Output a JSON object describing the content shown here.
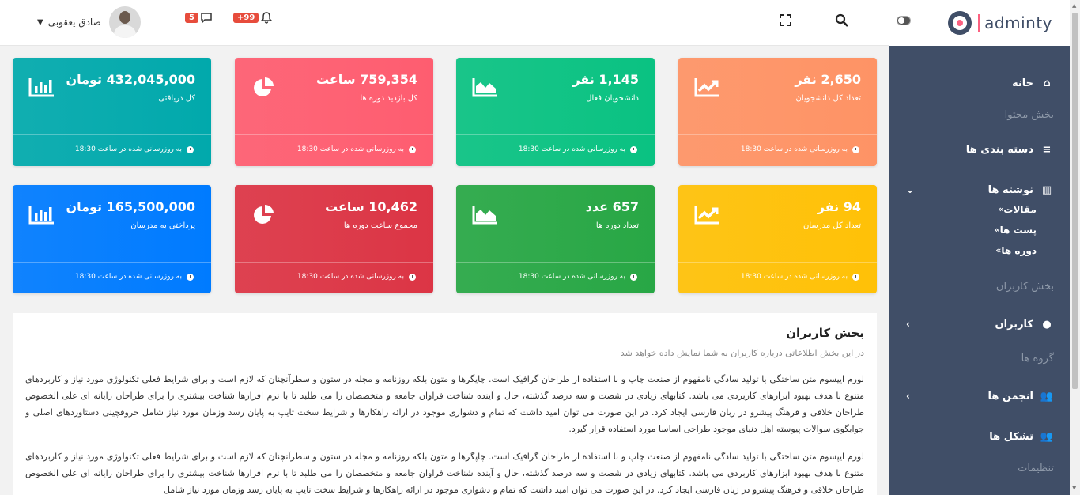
{
  "topbar": {
    "user_name": "صادق یعقوبی",
    "messages_count": "5",
    "notifications_count": "+99"
  },
  "sidebar": {
    "logo_text": "adminty",
    "home": "خانه",
    "caption_content": "بخش محتوا",
    "categories": "دسته بندی ها",
    "posts": "نوشته ها",
    "sub_articles": "مقالات",
    "sub_posts": "پست ها",
    "sub_courses": "دوره ها",
    "caption_users": "بخش کاربران",
    "users": "کاربران",
    "caption_groups": "گروه ها",
    "forums": "انجمن ها",
    "organizations": "تشکل ها",
    "caption_settings": "تنظیمات"
  },
  "cards": [
    {
      "value": "2,650 نفر",
      "label": "تعداد کل دانشجویان",
      "footer": "به روزرسانی شده در ساعت 18:30",
      "icon": "line-chart-icon",
      "color": "#fe9365"
    },
    {
      "value": "1,145 نفر",
      "label": "دانشجویان فعال",
      "footer": "به روزرسانی شده در ساعت 18:30",
      "icon": "area-chart-icon",
      "color": "#0ac282"
    },
    {
      "value": "759,354 ساعت",
      "label": "کل بازدید دوره ها",
      "footer": "به روزرسانی شده در ساعت 18:30",
      "icon": "pie-chart-icon",
      "color": "#fe5d70"
    },
    {
      "value": "432,045,000 تومان",
      "label": "کل دریافتی",
      "footer": "به روزرسانی شده در ساعت 18:30",
      "icon": "bar-chart-icon",
      "color": "#01a9ac"
    },
    {
      "value": "94 نفر",
      "label": "تعداد کل مدرسان",
      "footer": "به روزرسانی شده در ساعت 18:30",
      "icon": "line-chart-icon",
      "color": "#ffc107"
    },
    {
      "value": "657 عدد",
      "label": "تعداد دوره ها",
      "footer": "به روزرسانی شده در ساعت 18:30",
      "icon": "area-chart-icon",
      "color": "#28a745"
    },
    {
      "value": "10,462 ساعت",
      "label": "مجموع ساعت دوره ها",
      "footer": "به روزرسانی شده در ساعت 18:30",
      "icon": "pie-chart-icon",
      "color": "#dc3545"
    },
    {
      "value": "165,500,000 تومان",
      "label": "پرداختی به مدرسان",
      "footer": "به روزرسانی شده در ساعت 18:30",
      "icon": "bar-chart-icon",
      "color": "#007bff"
    }
  ],
  "panel": {
    "title": "بخش کاربران",
    "subtitle": "در این بخش اطلاعاتی درباره کاربران به شما نمایش داده خواهد شد",
    "paragraph1": "لورم ایپسوم متن ساختگی با تولید سادگی نامفهوم از صنعت چاپ و با استفاده از طراحان گرافیک است. چاپگرها و متون بلکه روزنامه و مجله در ستون و سطرآنچنان که لازم است و برای شرایط فعلی تکنولوژی مورد نیاز و کاربردهای متنوع با هدف بهبود ابزارهای کاربردی می باشد. کتابهای زیادی در شصت و سه درصد گذشته، حال و آینده شناخت فراوان جامعه و متخصصان را می طلبد تا با نرم افزارها شناخت بیشتری را برای طراحان رایانه ای علی الخصوص طراحان خلاقی و فرهنگ پیشرو در زبان فارسی ایجاد کرد. در این صورت می توان امید داشت که تمام و دشواری موجود در ارائه راهکارها و شرایط سخت تایپ به پایان رسد وزمان مورد نیاز شامل حروفچینی دستاوردهای اصلی و جوابگوی سوالات پیوسته اهل دنیای موجود طراحی اساسا مورد استفاده قرار گیرد.",
    "paragraph2": "لورم ایپسوم متن ساختگی با تولید سادگی نامفهوم از صنعت چاپ و با استفاده از طراحان گرافیک است. چاپگرها و متون بلکه روزنامه و مجله در ستون و سطرآنچنان که لازم است و برای شرایط فعلی تکنولوژی مورد نیاز و کاربردهای متنوع با هدف بهبود ابزارهای کاربردی می باشد. کتابهای زیادی در شصت و سه درصد گذشته، حال و آینده شناخت فراوان جامعه و متخصصان را می طلبد تا با نرم افزارها شناخت بیشتری را برای طراحان رایانه ای علی الخصوص طراحان خلاقی و فرهنگ پیشرو در زبان فارسی ایجاد کرد. در این صورت می توان امید داشت که تمام و دشواری موجود در ارائه راهکارها و شرایط سخت تایپ به پایان رسد وزمان مورد نیاز شامل"
  }
}
